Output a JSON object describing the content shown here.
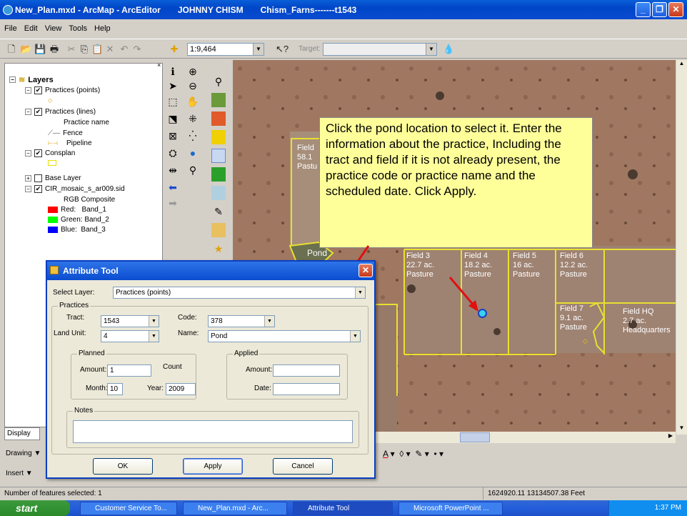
{
  "window": {
    "app_icon": "globe-icon",
    "title": "New_Plan.mxd - ArcMap - ArcEditor",
    "user": "JOHNNY CHISM",
    "farm": "Chism_Farns-------t1543"
  },
  "menu": [
    "File",
    "Edit",
    "View",
    "Tools",
    "Help"
  ],
  "toolbar": {
    "scale": "1:9,464",
    "target_label": "Target:"
  },
  "toc": {
    "root": "Layers",
    "layers": [
      {
        "label": "Practices (points)"
      },
      {
        "label": "Practices (lines)"
      },
      {
        "label": "Practice name"
      },
      {
        "label": "Fence"
      },
      {
        "label": "Pipeline"
      },
      {
        "label": "Consplan"
      },
      {
        "label": "Base Layer"
      },
      {
        "label": "CIR_mosaic_s_ar009.sid"
      },
      {
        "label": "RGB Composite"
      },
      {
        "label": "Red:   Band_1",
        "color": "#ff0000"
      },
      {
        "label": "Green: Band_2",
        "color": "#00ff00"
      },
      {
        "label": "Blue:  Band_3",
        "color": "#0000ff"
      }
    ],
    "display_tab": "Display"
  },
  "bottom": {
    "drawing": "Drawing",
    "insert": "Insert"
  },
  "callout": "Click the pond location to select it. Enter the information about the practice, Including the tract and field if it is not already present, the practice code or practice name and the scheduled date. Click Apply.",
  "map_labels": [
    {
      "text": "Field\n58.1\nPastu"
    },
    {
      "text": "Pond"
    },
    {
      "text": "Field 3\n22.7 ac.\nPasture"
    },
    {
      "text": "Field 4\n18.2 ac.\nPasture"
    },
    {
      "text": "Field 5\n16 ac.\nPasture"
    },
    {
      "text": "Field 6\n12.2 ac.\nPasture"
    },
    {
      "text": "Field 7\n9.1 ac.\nPasture"
    },
    {
      "text": "Field HQ\n2.7 ac.\nHeadquarters"
    }
  ],
  "dialog": {
    "title": "Attribute Tool",
    "select_layer_label": "Select Layer:",
    "select_layer_value": "Practices (points)",
    "practices_group": "Practices",
    "tract_label": "Tract:",
    "tract_value": "1543",
    "code_label": "Code:",
    "code_value": "378",
    "land_unit_label": "Land Unit:",
    "land_unit_value": "4",
    "name_label": "Name:",
    "name_value": "Pond",
    "planned_group": "Planned",
    "amount_label": "Amount:",
    "planned_amount": "1",
    "count_label": "Count",
    "month_label": "Month:",
    "month_value": "10",
    "year_label": "Year:",
    "year_value": "2009",
    "applied_group": "Applied",
    "applied_amount_label": "Amount:",
    "applied_amount": "",
    "date_label": "Date:",
    "date_value": "",
    "notes_group": "Notes",
    "notes_value": "",
    "ok": "OK",
    "apply": "Apply",
    "cancel": "Cancel"
  },
  "status": {
    "selected": "Number of features selected: 1",
    "coords": "1624920.11  13134507.38 Feet"
  },
  "taskbar": {
    "start": "start",
    "tasks": [
      "Customer Service To...",
      "New_Plan.mxd - Arc...",
      "Attribute Tool",
      "Microsoft PowerPoint ..."
    ],
    "clock": "1:37 PM"
  }
}
